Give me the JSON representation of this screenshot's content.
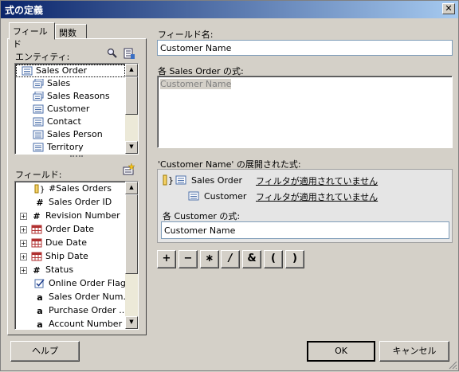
{
  "window": {
    "title": "式の定義",
    "close_label": "✕"
  },
  "tabs": [
    {
      "label": "フィールド"
    },
    {
      "label": "関数"
    }
  ],
  "entities": {
    "label": "エンティティ:",
    "items": [
      {
        "label": "Sales Order",
        "icon": "entity-icon"
      },
      {
        "label": "Sales",
        "icon": "stacked-entity-icon"
      },
      {
        "label": "Sales Reasons",
        "icon": "stacked-entity-icon"
      },
      {
        "label": "Customer",
        "icon": "entity-icon"
      },
      {
        "label": "Contact",
        "icon": "entity-icon"
      },
      {
        "label": "Sales Person",
        "icon": "entity-icon"
      },
      {
        "label": "Territory",
        "icon": "entity-icon"
      }
    ]
  },
  "fields": {
    "label": "フィールド:",
    "items": [
      {
        "label": "#Sales Orders",
        "icon": "aggregate-icon",
        "expandable": false
      },
      {
        "label": "Sales Order ID",
        "icon": "number-icon",
        "expandable": false
      },
      {
        "label": "Revision Number",
        "icon": "number-icon",
        "expandable": true
      },
      {
        "label": "Order Date",
        "icon": "calendar-icon",
        "expandable": true
      },
      {
        "label": "Due Date",
        "icon": "calendar-icon",
        "expandable": true
      },
      {
        "label": "Ship Date",
        "icon": "calendar-icon",
        "expandable": true
      },
      {
        "label": "Status",
        "icon": "number-icon",
        "expandable": true
      },
      {
        "label": "Online Order Flag",
        "icon": "checkbox-icon",
        "expandable": false
      },
      {
        "label": "Sales Order Num...",
        "icon": "text-icon",
        "expandable": false
      },
      {
        "label": "Purchase Order ...",
        "icon": "text-icon",
        "expandable": false
      },
      {
        "label": "Account Number",
        "icon": "text-icon",
        "expandable": false
      }
    ]
  },
  "field_name": {
    "label": "フィールド名:",
    "value": "Customer Name"
  },
  "formula": {
    "label": "各 Sales Order の式:",
    "value": "Customer Name"
  },
  "expanded": {
    "label": "'Customer Name' の展開された式:",
    "rows": [
      {
        "entity": "Sales Order",
        "filter": "フィルタが適用されていません"
      },
      {
        "entity": "Customer",
        "filter": "フィルタが適用されていません"
      }
    ],
    "sub_label": "各 Customer の式:",
    "sub_value": "Customer Name"
  },
  "operators": [
    "+",
    "−",
    "∗",
    "/",
    "&",
    "(",
    ")"
  ],
  "buttons": {
    "help": "ヘルプ",
    "ok": "OK",
    "cancel": "キャンセル"
  }
}
